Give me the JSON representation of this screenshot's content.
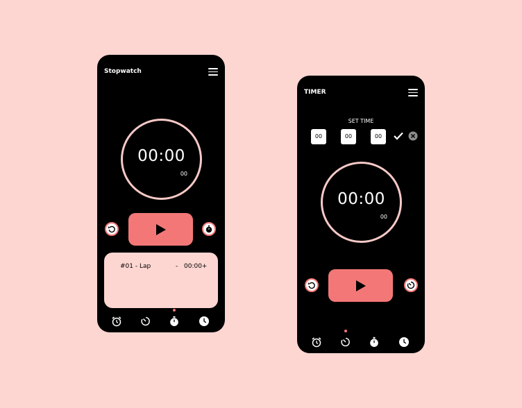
{
  "colors": {
    "background": "#fdd6d2",
    "accent": "#f47777",
    "ring": "#f6c9c6",
    "phone": "#000000"
  },
  "stopwatch": {
    "title": "Stopwatch",
    "time": "00:00",
    "subtime": "00",
    "lap": {
      "label": "#01 - Lap",
      "dash": "-",
      "value": "00:00+"
    },
    "nav_icons": [
      "alarm-clock-icon",
      "timer-icon",
      "stopwatch-icon",
      "clock-icon"
    ],
    "nav_active": "stopwatch-icon"
  },
  "timer": {
    "title": "TIMER",
    "set_time_label": "SET TIME",
    "inputs": [
      "00",
      "00",
      "00"
    ],
    "time": "00:00",
    "subtime": "00",
    "nav_icons": [
      "alarm-clock-icon",
      "timer-icon",
      "stopwatch-icon",
      "clock-icon"
    ],
    "nav_active": "timer-icon"
  }
}
